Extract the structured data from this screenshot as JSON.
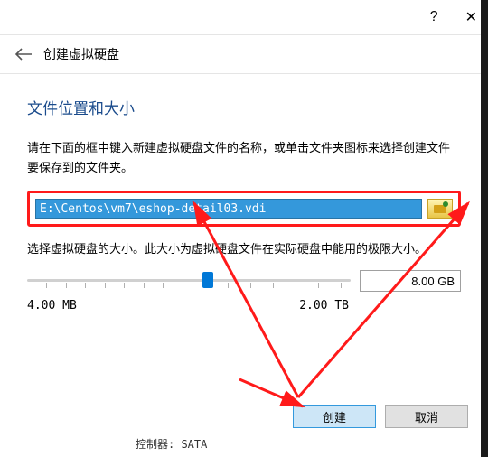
{
  "titlebar": {
    "help": "?",
    "close": "✕"
  },
  "header": {
    "title": "创建虚拟硬盘"
  },
  "section": {
    "title": "文件位置和大小",
    "desc1": "请在下面的框中键入新建虚拟硬盘文件的名称，或单击文件夹图标来选择创建文件要保存到的文件夹。",
    "path_value": "E:\\Centos\\vm7\\eshop-detail03.vdi",
    "desc2": "选择虚拟硬盘的大小。此大小为虚拟硬盘文件在实际硬盘中能用的极限大小。",
    "size_value": "8.00 GB",
    "min_label": "4.00 MB",
    "max_label": "2.00 TB"
  },
  "footer": {
    "create": "创建",
    "cancel": "取消"
  },
  "fragment": {
    "controller": "控制器: SATA"
  }
}
